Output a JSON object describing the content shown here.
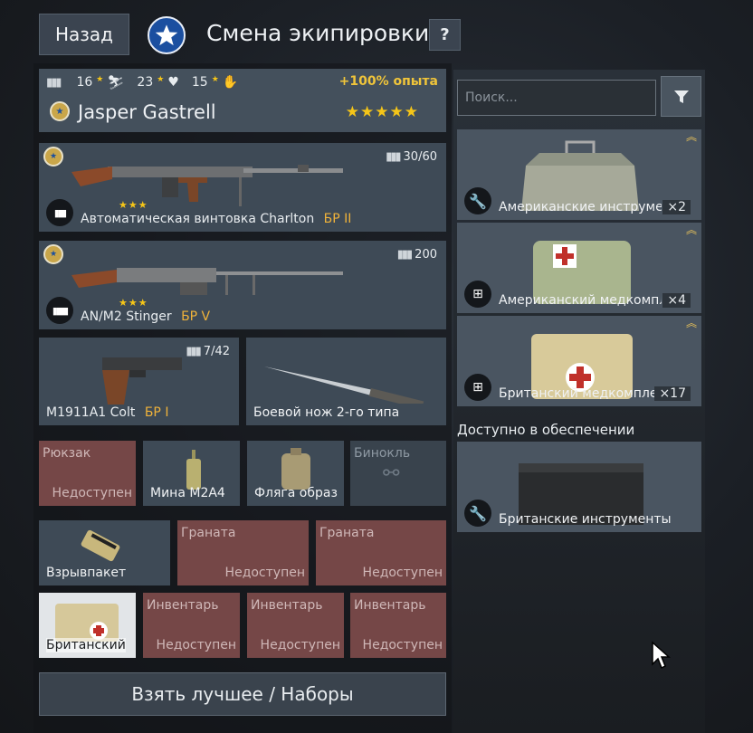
{
  "header": {
    "back_label": "Назад",
    "title": "Смена экипировки",
    "help_label": "?"
  },
  "soldier": {
    "stat_1": "16",
    "stat_2": "23",
    "stat_3": "15",
    "exp_bonus": "+100% опыта",
    "name": "Jasper Gastrell",
    "stars": "★★★★★"
  },
  "weapons": {
    "primary": {
      "name": "Автоматическая винтовка Charlton",
      "br": "БР II",
      "ammo": "30/60",
      "stars": "★★★"
    },
    "secondary": {
      "name": "AN/M2 Stinger",
      "br": "БР V",
      "ammo": "200",
      "stars": "★★★"
    },
    "pistol": {
      "name": "M1911A1 Colt",
      "br": "БР I",
      "ammo": "7/42"
    },
    "melee": {
      "name": "Боевой нож 2-го типа"
    }
  },
  "slots_row1": [
    {
      "title": "Рюкзак",
      "status": "Недоступен"
    },
    {
      "label": "Мина М2А4"
    },
    {
      "label": "Фляга образ"
    },
    {
      "title": "Бинокль"
    }
  ],
  "slots_row2": [
    {
      "label": "Взрывпакет"
    },
    {
      "title": "Граната",
      "status": "Недоступен"
    },
    {
      "title": "Граната",
      "status": "Недоступен"
    }
  ],
  "slots_row3": [
    {
      "label": "Британский"
    },
    {
      "title": "Инвентарь",
      "status": "Недоступен"
    },
    {
      "title": "Инвентарь",
      "status": "Недоступен"
    },
    {
      "title": "Инвентарь",
      "status": "Недоступен"
    }
  ],
  "best_button_label": "Взять лучшее / Наборы",
  "search": {
    "placeholder": "Поиск..."
  },
  "inventory": [
    {
      "name": "Американские инструменты",
      "count": "×2",
      "icon": "wrench-icon"
    },
    {
      "name": "Американский медкомплект",
      "count": "×4",
      "icon": "medkit-icon"
    },
    {
      "name": "Британский медкомплект",
      "count": "×17",
      "icon": "medkit-icon"
    }
  ],
  "supply": {
    "label": "Доступно в обеспечении",
    "items": [
      {
        "name": "Британские инструменты",
        "icon": "wrench-icon"
      }
    ]
  },
  "colors": {
    "accent_gold": "#f5c518",
    "br_orange": "#f0b33a",
    "locked_red": "#7b4a4a"
  }
}
